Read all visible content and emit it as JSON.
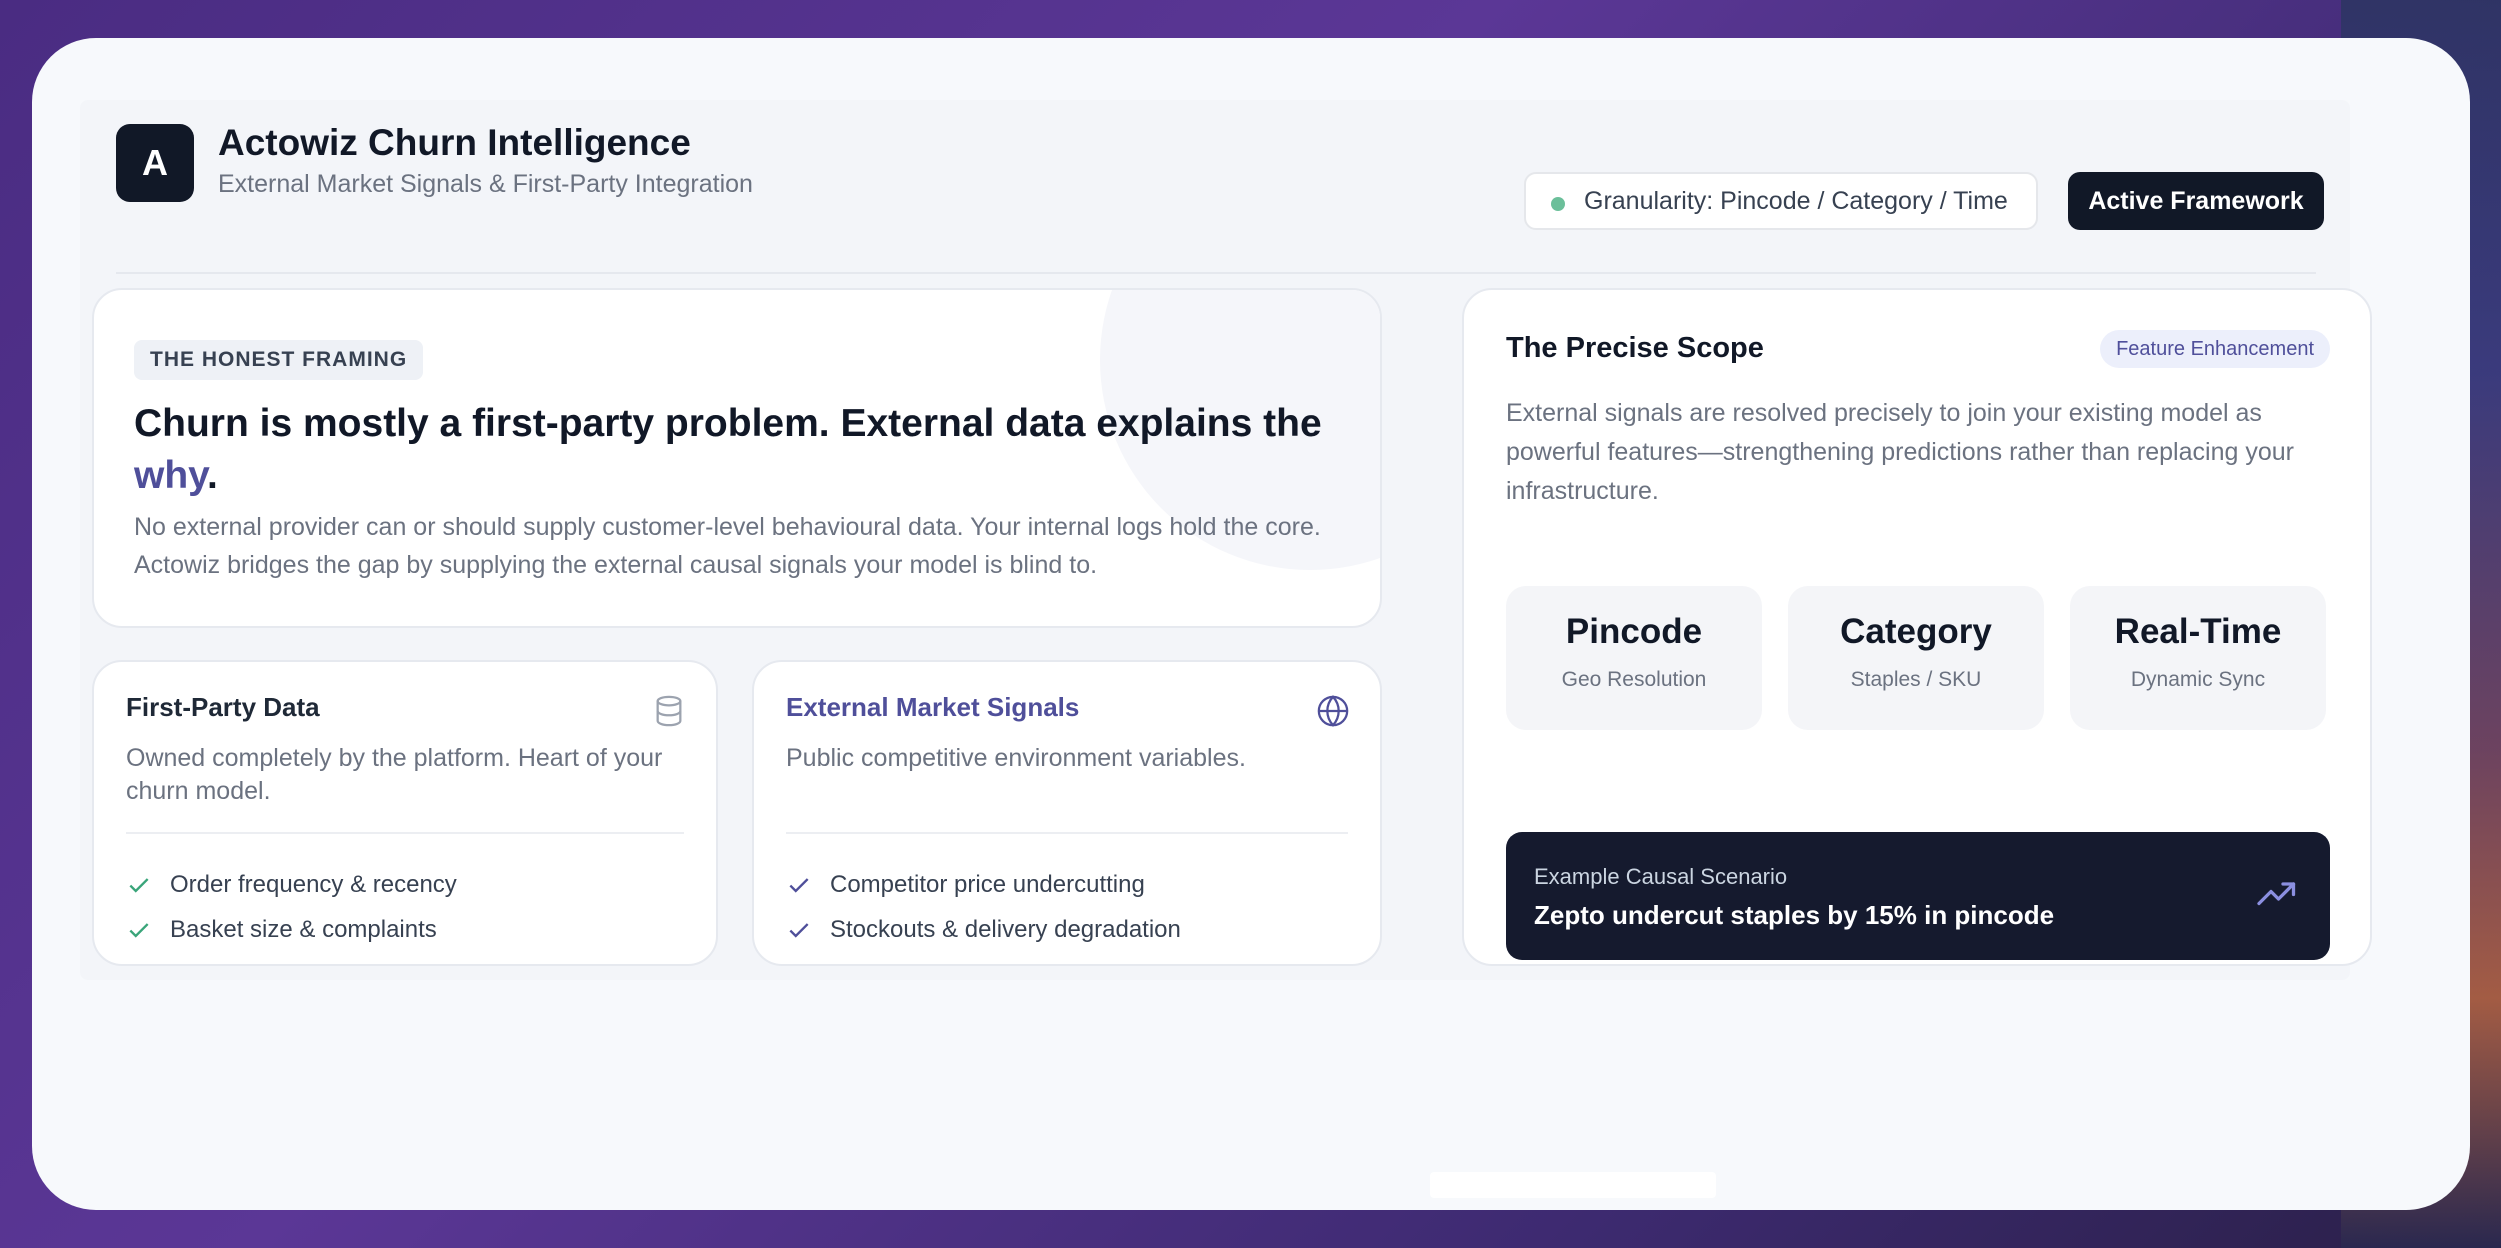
{
  "header": {
    "logo_letter": "A",
    "title": "Actowiz Churn Intelligence",
    "subtitle": "External Market Signals & First-Party Integration",
    "granularity": "Granularity: Pincode / Category / Time",
    "active_button": "Active Framework"
  },
  "framing": {
    "pill": "THE HONEST FRAMING",
    "headline_main": "Churn is mostly a first-party problem. External data explains the ",
    "headline_accent": "why",
    "headline_end": ".",
    "body": "No external provider can or should supply customer-level behavioural data. Your internal logs hold the core. Actowiz bridges the gap by supplying the external causal signals your model is blind to."
  },
  "first_party": {
    "title": "First-Party Data",
    "icon": "database-icon",
    "description": "Owned completely by the platform. Heart of your churn model.",
    "items": [
      "Order frequency & recency",
      "Basket size & complaints"
    ],
    "check_color": "#3aa57a"
  },
  "market_signals": {
    "title": "External Market Signals",
    "icon": "globe-icon",
    "description": "Public competitive environment variables.",
    "items": [
      "Competitor price undercutting",
      "Stockouts & delivery degradation"
    ],
    "check_color": "#4f4f9a"
  },
  "scope": {
    "title": "The Precise Scope",
    "badge": "Feature Enhancement",
    "body": "External signals are resolved precisely to join your existing model as powerful features—strengthening predictions rather than replacing your infrastructure.",
    "metrics": [
      {
        "value": "Pincode",
        "label": "Geo Resolution"
      },
      {
        "value": "Category",
        "label": "Staples / SKU"
      },
      {
        "value": "Real-Time",
        "label": "Dynamic Sync"
      }
    ],
    "scenario": {
      "label": "Example Causal Scenario",
      "text": "Zepto undercut staples by 15% in pincode",
      "icon": "trending-up-icon"
    }
  },
  "colors": {
    "accent": "#4f4f9a",
    "dark": "#111827",
    "status_dot": "#6bbf9a"
  }
}
